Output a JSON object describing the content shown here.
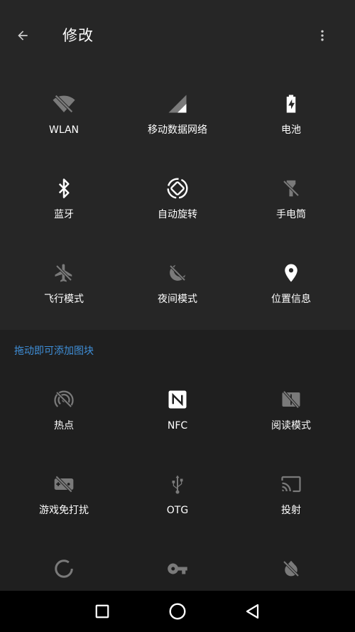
{
  "header": {
    "title": "修改",
    "back_icon": "arrow-back-icon",
    "more_icon": "more-vert-icon"
  },
  "active_tiles": [
    {
      "label": "WLAN",
      "icon": "wifi-off-icon"
    },
    {
      "label": "移动数据网络",
      "icon": "signal-icon"
    },
    {
      "label": "电池",
      "icon": "battery-charging-icon"
    },
    {
      "label": "蓝牙",
      "icon": "bluetooth-icon"
    },
    {
      "label": "自动旋转",
      "icon": "screen-rotation-icon"
    },
    {
      "label": "手电筒",
      "icon": "flashlight-off-icon"
    },
    {
      "label": "飞行模式",
      "icon": "airplane-off-icon"
    },
    {
      "label": "夜间模式",
      "icon": "night-mode-off-icon"
    },
    {
      "label": "位置信息",
      "icon": "location-icon"
    }
  ],
  "available": {
    "hint": "拖动即可添加图块",
    "tiles": [
      {
        "label": "热点",
        "icon": "hotspot-off-icon"
      },
      {
        "label": "NFC",
        "icon": "nfc-icon"
      },
      {
        "label": "阅读模式",
        "icon": "reading-mode-off-icon"
      },
      {
        "label": "游戏免打扰",
        "icon": "game-mode-off-icon"
      },
      {
        "label": "OTG",
        "icon": "usb-icon"
      },
      {
        "label": "投射",
        "icon": "cast-icon"
      },
      {
        "label": "",
        "icon": "data-saver-icon"
      },
      {
        "label": "",
        "icon": "vpn-key-icon"
      },
      {
        "label": "",
        "icon": "invert-colors-off-icon"
      }
    ]
  },
  "colors": {
    "accent": "#3f8fd8",
    "background": "#262626",
    "icon_active": "#ffffff",
    "icon_inactive": "#7a7a7a"
  },
  "navbar": {
    "recents_icon": "recents-square-icon",
    "home_icon": "home-circle-icon",
    "back_icon": "back-triangle-icon"
  }
}
